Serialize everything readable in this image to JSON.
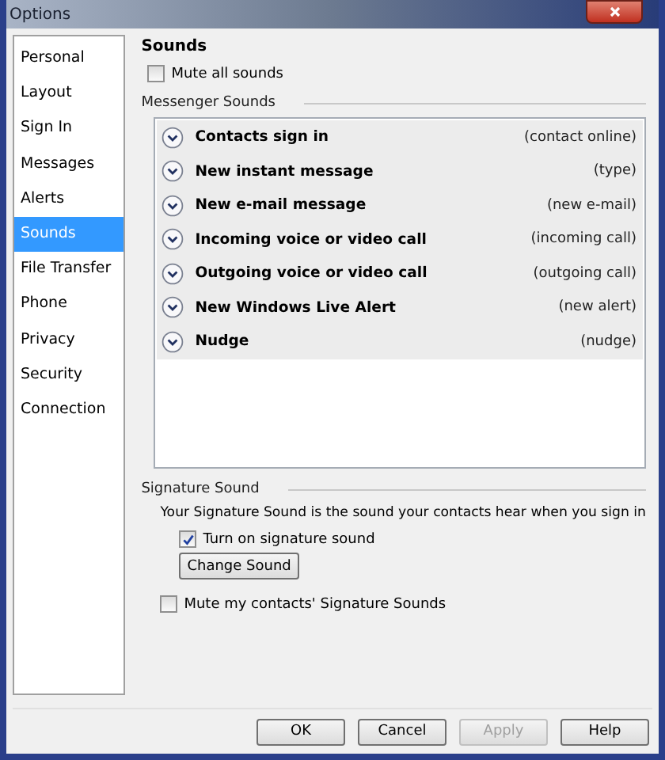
{
  "window": {
    "title": "Options"
  },
  "sidebar": {
    "items": [
      {
        "label": "Personal",
        "selected": false
      },
      {
        "label": "Layout",
        "selected": false
      },
      {
        "label": "Sign In",
        "selected": false
      },
      {
        "label": "Messages",
        "selected": false
      },
      {
        "label": "Alerts",
        "selected": false
      },
      {
        "label": "Sounds",
        "selected": true
      },
      {
        "label": "File Transfer",
        "selected": false
      },
      {
        "label": "Phone",
        "selected": false
      },
      {
        "label": "Privacy",
        "selected": false
      },
      {
        "label": "Security",
        "selected": false
      },
      {
        "label": "Connection",
        "selected": false
      }
    ]
  },
  "heading": "Sounds",
  "mute_all": {
    "label": "Mute all sounds",
    "checked": false
  },
  "messenger_sounds": {
    "title": "Messenger Sounds",
    "items": [
      {
        "name": "Contacts sign in",
        "sound": "(contact online)"
      },
      {
        "name": "New instant message",
        "sound": "(type)"
      },
      {
        "name": "New e-mail message",
        "sound": "(new e-mail)"
      },
      {
        "name": "Incoming voice or video call",
        "sound": "(incoming call)"
      },
      {
        "name": "Outgoing voice or video call",
        "sound": "(outgoing call)"
      },
      {
        "name": "New Windows Live Alert",
        "sound": "(new alert)"
      },
      {
        "name": "Nudge",
        "sound": "(nudge)"
      }
    ]
  },
  "signature_sound": {
    "title": "Signature Sound",
    "description": "Your Signature Sound is the sound your contacts hear when you sign in",
    "turn_on": {
      "label": "Turn on signature sound",
      "checked": true
    },
    "change_button": "Change Sound",
    "mute_contacts": {
      "label": "Mute my contacts' Signature Sounds",
      "checked": false
    }
  },
  "buttons": [
    {
      "label": "OK",
      "disabled": false
    },
    {
      "label": "Cancel",
      "disabled": false
    },
    {
      "label": "Apply",
      "disabled": true
    },
    {
      "label": "Help",
      "disabled": false
    }
  ]
}
